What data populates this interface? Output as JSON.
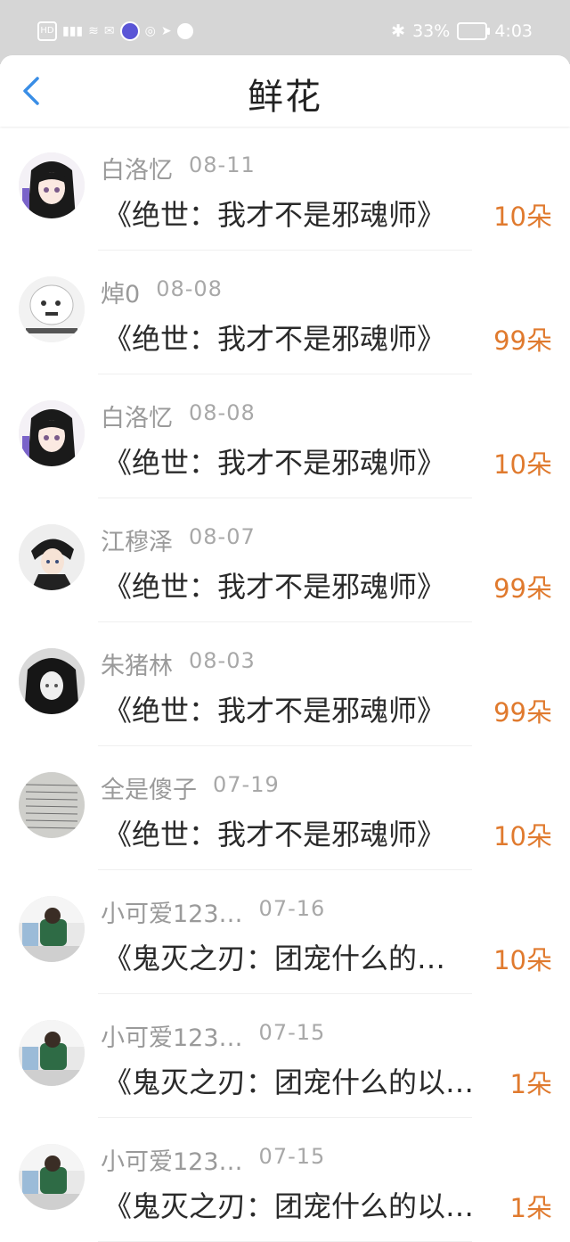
{
  "status_bar": {
    "left_icons": [
      "hd-icon",
      "signal-4g-icon",
      "wifi-icon",
      "message-icon",
      "music-icon",
      "camera-icon",
      "send-icon",
      "chat-icon"
    ],
    "battery": "33%",
    "time": "4:03"
  },
  "header": {
    "title": "鲜花"
  },
  "colors": {
    "accent_blue": "#3a8ee6",
    "count_orange": "#e07a2e",
    "meta_gray": "#9a9a9a"
  },
  "items": [
    {
      "user": "白洛忆",
      "date": "08-11",
      "book": "《绝世：我才不是邪魂师》",
      "count": "10朵",
      "avatar": "anime-girl-avatar"
    },
    {
      "user": "焯0",
      "date": "08-08",
      "book": "《绝世：我才不是邪魂师》",
      "count": "99朵",
      "avatar": "meme-face-avatar"
    },
    {
      "user": "白洛忆",
      "date": "08-08",
      "book": "《绝世：我才不是邪魂师》",
      "count": "10朵",
      "avatar": "anime-girl-avatar"
    },
    {
      "user": "江穆泽",
      "date": "08-07",
      "book": "《绝世：我才不是邪魂师》",
      "count": "99朵",
      "avatar": "anime-boy-avatar"
    },
    {
      "user": "朱猪林",
      "date": "08-03",
      "book": "《绝世：我才不是邪魂师》",
      "count": "99朵",
      "avatar": "dark-girl-avatar"
    },
    {
      "user": "全是傻子",
      "date": "07-19",
      "book": "《绝世：我才不是邪魂师》",
      "count": "10朵",
      "avatar": "paper-avatar"
    },
    {
      "user": "小可爱123…",
      "date": "07-16",
      "book": "《鬼灭之刃：团宠什么的…",
      "count": "10朵",
      "avatar": "photo-child-avatar"
    },
    {
      "user": "小可爱123…",
      "date": "07-15",
      "book": "《鬼灭之刃：团宠什么的以…",
      "count": "1朵",
      "avatar": "photo-child-avatar"
    },
    {
      "user": "小可爱123…",
      "date": "07-15",
      "book": "《鬼灭之刃：团宠什么的以…",
      "count": "1朵",
      "avatar": "photo-child-avatar"
    }
  ]
}
